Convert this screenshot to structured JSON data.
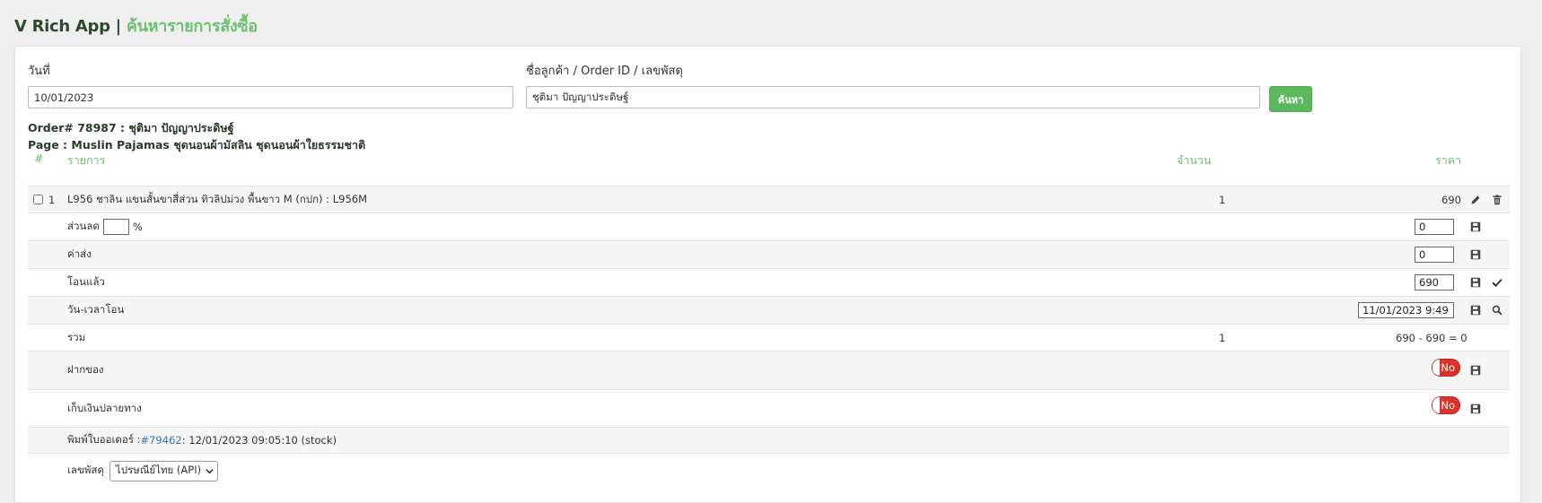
{
  "header": {
    "brand": "V Rich App |",
    "page_title": "ค้นหารายการสั่งซื้อ"
  },
  "search": {
    "date_label": "วันที่",
    "date_value": "10/01/2023",
    "query_label": "ชื่อลูกค้า / Order ID / เลขพัสดุ",
    "query_value": "ชุติมา ปัญญาประดิษฐ์",
    "button_label": "ค้นหา"
  },
  "order": {
    "order_line": "Order# 78987 : ชุติมา ปัญญาประดิษฐ์",
    "page_line": "Page : Muslin Pajamas ชุดนอนผ้ามัสลิน ชุดนอนผ้าใยธรรมชาติ"
  },
  "table": {
    "headers": {
      "index": "#",
      "item": "รายการ",
      "qty": "จำนวน",
      "price": "ราคา"
    },
    "items": [
      {
        "index": "1",
        "name": "L956 ชาลิน แขนสั้นขาสี่ส่วน ทิวลิปม่วง พื้นขาว M (กปก) : L956M",
        "qty": "1",
        "price": "690"
      }
    ],
    "discount": {
      "label": "ส่วนลด",
      "percent_value": "",
      "percent_sign": "%",
      "amount": "0"
    },
    "shipping": {
      "label": "ค่าส่ง",
      "amount": "0"
    },
    "paid": {
      "label": "โอนแล้ว",
      "amount": "690"
    },
    "transfer_time": {
      "label": "วัน-เวลาโอน",
      "value": "11/01/2023 9:49"
    },
    "total": {
      "label": "รวม",
      "qty": "1",
      "value": "690 - 690 = 0"
    },
    "deposit": {
      "label": "ฝากของ",
      "toggle": "No"
    },
    "cod": {
      "label": "เก็บเงินปลายทาง",
      "toggle": "No"
    },
    "print": {
      "prefix": "พิมพ์ใบออเดอร์ : ",
      "link": "#79462",
      "suffix": " : 12/01/2023 09:05:10 (stock)"
    },
    "tracking": {
      "label": "เลขพัสดุ",
      "carrier": "ไปรษณีย์ไทย (API)"
    }
  },
  "colors": {
    "accent": "#6cc070",
    "button": "#5cb85c",
    "toggle_off": "#d9342b",
    "link": "#337ab7"
  },
  "icons": [
    "pencil-icon",
    "trash-icon",
    "save-icon",
    "check-icon",
    "search-icon",
    "chevron-down-icon"
  ]
}
